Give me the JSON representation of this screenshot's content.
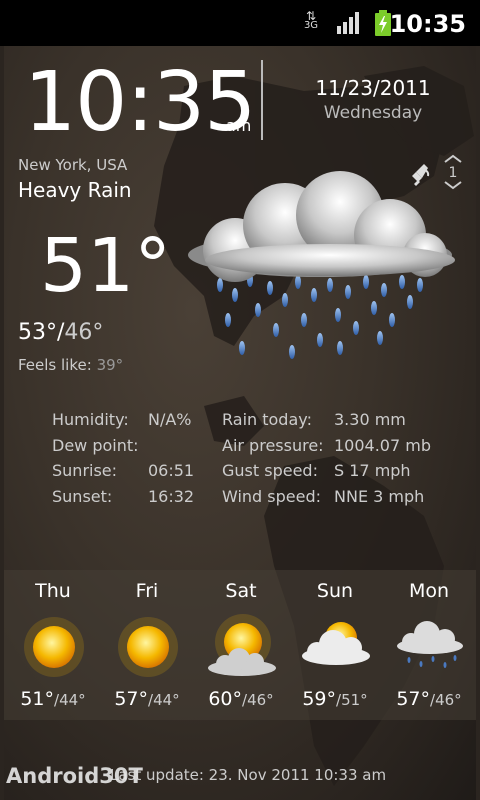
{
  "status_bar": {
    "network": "3G",
    "time": "10:35"
  },
  "clock": {
    "time": "10:35",
    "ampm": "am",
    "date": "11/23/2011",
    "weekday": "Wednesday"
  },
  "current": {
    "location": "New York, USA",
    "condition": "Heavy Rain",
    "temperature": "51°",
    "high": "53°",
    "separator": "/",
    "low": "46°",
    "feels_like_label": "Feels like:",
    "feels_like_value": "39°"
  },
  "page_indicator": "1",
  "details": {
    "humidity_label": "Humidity:",
    "humidity_value": "N/A%",
    "dew_label": "Dew point:",
    "dew_value": "",
    "sunrise_label": "Sunrise:",
    "sunrise_value": "06:51",
    "sunset_label": "Sunset:",
    "sunset_value": "16:32",
    "rain_label": "Rain today:",
    "rain_value": "3.30 mm",
    "pressure_label": "Air pressure:",
    "pressure_value": "1004.07 mb",
    "gust_label": "Gust speed:",
    "gust_value": "S 17 mph",
    "wind_label": "Wind speed:",
    "wind_value": "NNE 3 mph"
  },
  "forecast": [
    {
      "day": "Thu",
      "high": "51°",
      "low": "/44°",
      "icon": "sun-icon"
    },
    {
      "day": "Fri",
      "high": "57°",
      "low": "/44°",
      "icon": "sun-icon"
    },
    {
      "day": "Sat",
      "high": "60°",
      "low": "/46°",
      "icon": "partly-cloudy-icon"
    },
    {
      "day": "Sun",
      "high": "59°",
      "low": "/51°",
      "icon": "mostly-cloudy-icon"
    },
    {
      "day": "Mon",
      "high": "57°",
      "low": "/46°",
      "icon": "light-rain-icon"
    }
  ],
  "footer": {
    "last_update": "Last update: 23. Nov 2011  10:33 am"
  },
  "watermark": "Android30T",
  "colors": {
    "status_bar": "#000000",
    "battery": "#7ccc2a",
    "rain_drop": "#3f6fb5",
    "sun": "#f5b800"
  }
}
